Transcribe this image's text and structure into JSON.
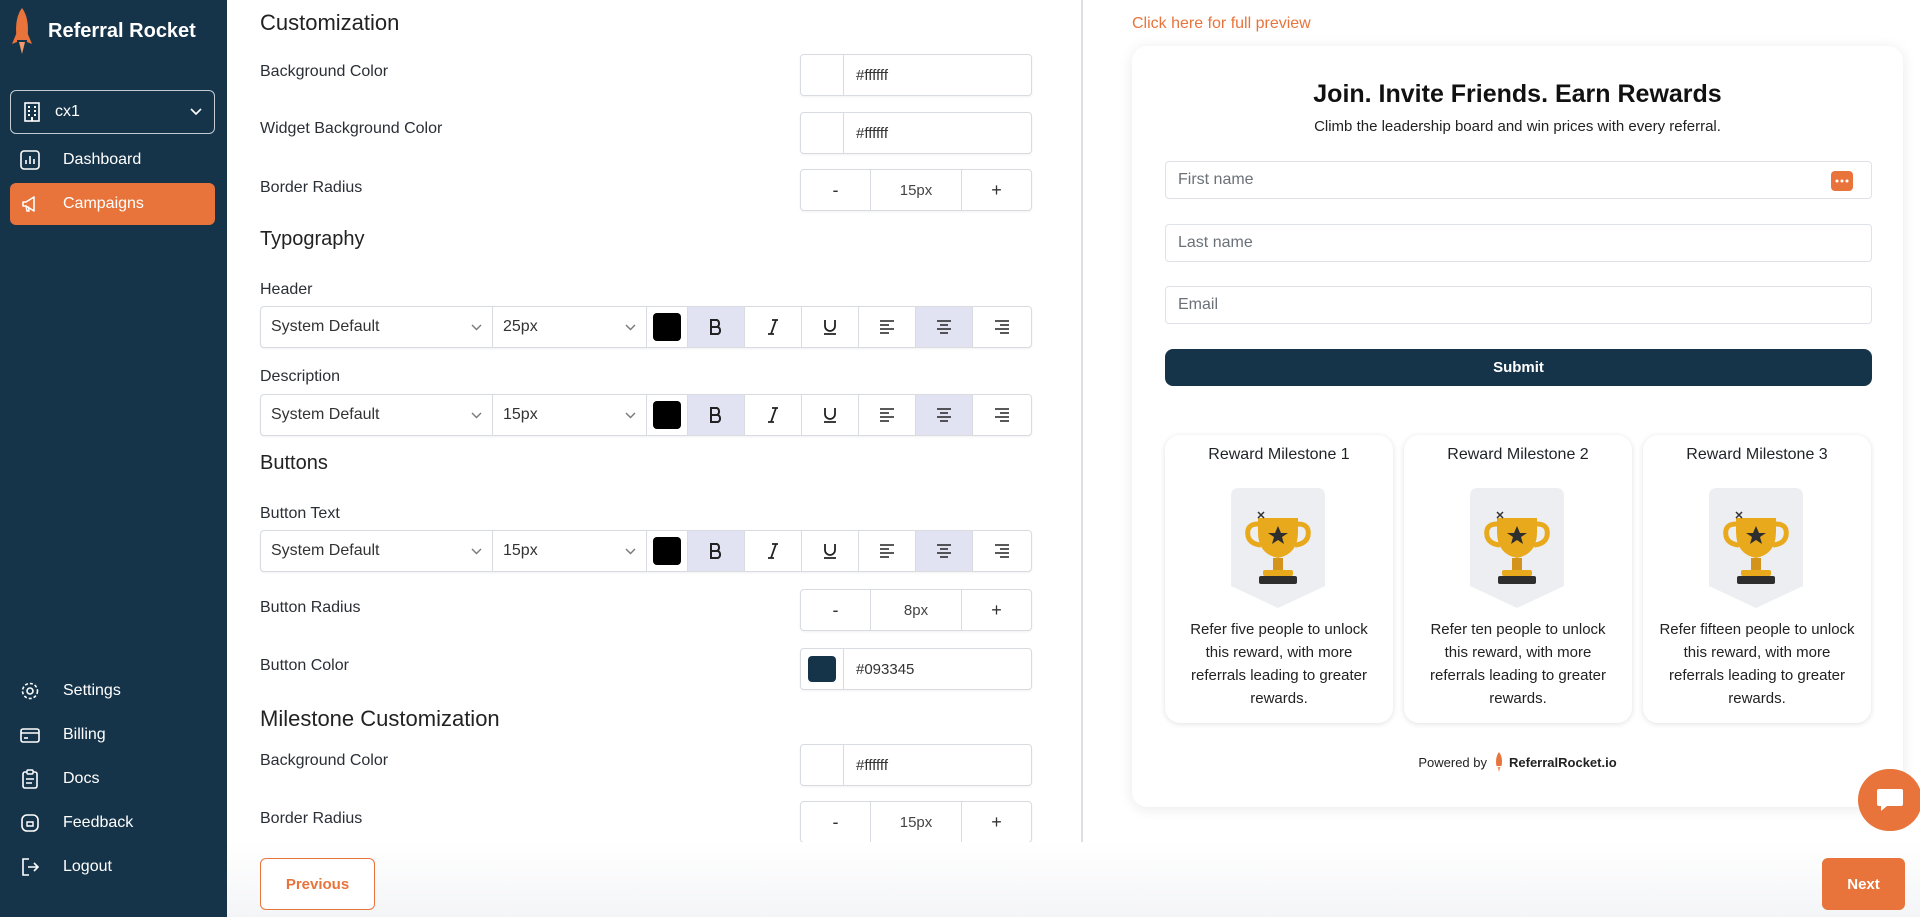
{
  "sidebar": {
    "brand": "Referral Rocket",
    "workspace": "cx1",
    "nav_top": [
      {
        "label": "Dashboard",
        "icon": "chart-icon"
      },
      {
        "label": "Campaigns",
        "icon": "megaphone-icon",
        "active": true
      }
    ],
    "nav_bottom": [
      {
        "label": "Settings",
        "icon": "gear-icon"
      },
      {
        "label": "Billing",
        "icon": "credit-card-icon"
      },
      {
        "label": "Docs",
        "icon": "clipboard-icon"
      },
      {
        "label": "Feedback",
        "icon": "feedback-icon"
      },
      {
        "label": "Logout",
        "icon": "logout-icon"
      }
    ]
  },
  "customization": {
    "title": "Customization",
    "background_color": {
      "label": "Background Color",
      "value": "#ffffff"
    },
    "widget_background_color": {
      "label": "Widget Background Color",
      "value": "#ffffff"
    },
    "border_radius": {
      "label": "Border Radius",
      "value": "15px",
      "minus": "-",
      "plus": "+"
    }
  },
  "typography": {
    "title": "Typography",
    "header": {
      "label": "Header",
      "font": "System Default",
      "size": "25px"
    },
    "description": {
      "label": "Description",
      "font": "System Default",
      "size": "15px"
    }
  },
  "buttons": {
    "title": "Buttons",
    "button_text": {
      "label": "Button Text",
      "font": "System Default",
      "size": "15px"
    },
    "button_radius": {
      "label": "Button Radius",
      "value": "8px",
      "minus": "-",
      "plus": "+"
    },
    "button_color": {
      "label": "Button Color",
      "value": "#093345"
    }
  },
  "milestone_customization": {
    "title": "Milestone Customization",
    "background_color": {
      "label": "Background Color",
      "value": "#ffffff"
    },
    "border_radius": {
      "label": "Border Radius",
      "value": "15px",
      "minus": "-",
      "plus": "+"
    }
  },
  "preview": {
    "link": "Click here for full preview",
    "title": "Join. Invite Friends. Earn Rewards",
    "description": "Climb the leadership board and win prices with every referral.",
    "first_name_placeholder": "First name",
    "last_name_placeholder": "Last name",
    "email_placeholder": "Email",
    "submit": "Submit",
    "milestones": [
      {
        "title": "Reward Milestone 1",
        "description": "Refer five people to unlock this reward, with more referrals leading to greater rewards."
      },
      {
        "title": "Reward Milestone 2",
        "description": "Refer ten people to unlock this reward, with more referrals leading to greater rewards."
      },
      {
        "title": "Reward Milestone 3",
        "description": "Refer fifteen people to unlock this reward, with more referrals leading to greater rewards."
      }
    ],
    "powered_by": "Powered by",
    "powered_brand": "ReferralRocket.io"
  },
  "footer": {
    "previous": "Previous",
    "next": "Next"
  },
  "colors": {
    "sidebar": "#163449",
    "accent": "#e8743b",
    "button": "#093345"
  }
}
